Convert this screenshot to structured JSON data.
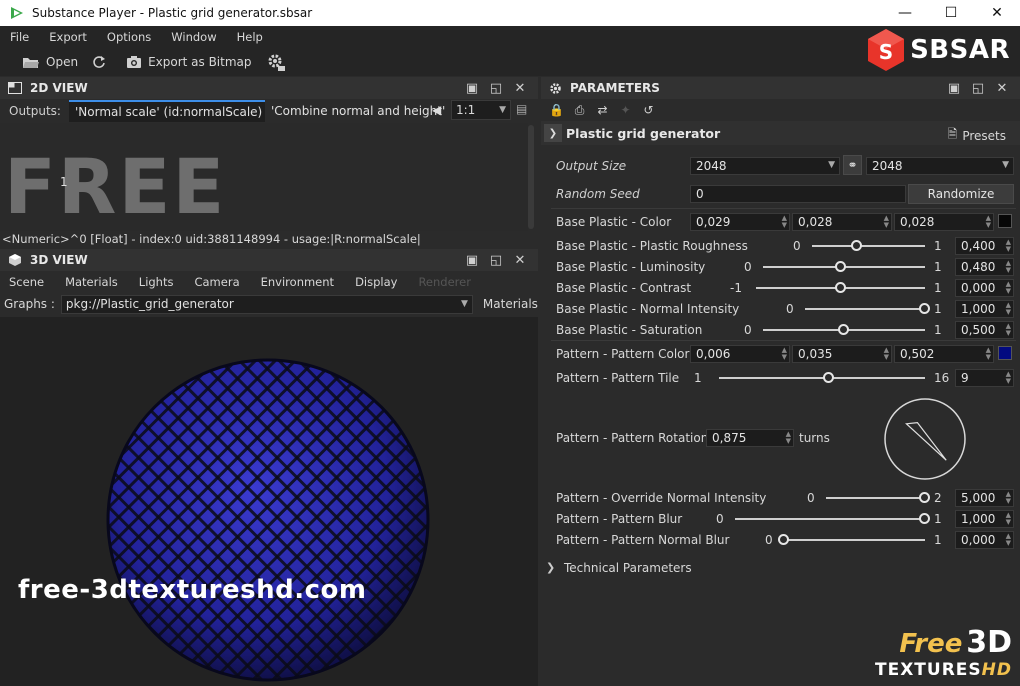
{
  "window": {
    "title": "Substance Player - Plastic grid generator.sbsar"
  },
  "menu": [
    "File",
    "Export",
    "Options",
    "Window",
    "Help"
  ],
  "toolbar": {
    "open_label": "Open",
    "export_label": "Export as Bitmap"
  },
  "logo": {
    "text": "SBSAR",
    "color": "#e8342a"
  },
  "view2d": {
    "title": "2D VIEW",
    "outputs_label": "Outputs:",
    "tab_active": "'Normal scale' (id:normalScale)",
    "tab_inactive": "'Combine normal and height' (i",
    "zoom": "1:1",
    "free_text": "FREE",
    "value_label": "1",
    "numeric_info": "<Numeric>^0 [Float] - index:0 uid:3881148994 - usage:|R:normalScale|"
  },
  "view3d": {
    "title": "3D VIEW",
    "menu": [
      "Scene",
      "Materials",
      "Lights",
      "Camera",
      "Environment",
      "Display",
      "Renderer"
    ],
    "graphs_label": "Graphs :",
    "graph_path": "pkg://Plastic_grid_generator",
    "materials_label": "Materials",
    "sphere_color": "#2a2a9e"
  },
  "parameters": {
    "title": "PARAMETERS",
    "graph_name": "Plastic grid generator",
    "presets_label": "Presets",
    "output_size_label": "Output Size",
    "output_size_w": "2048",
    "output_size_h": "2048",
    "random_seed_label": "Random Seed",
    "random_seed_value": "0",
    "randomize_label": "Randomize",
    "base_color": {
      "label": "Base Plastic  - Color",
      "r": "0,029",
      "g": "0,028",
      "b": "0,028",
      "swatch": "#070707"
    },
    "sliders": [
      {
        "label": "Base Plastic  - Plastic Roughness",
        "min": "0",
        "max": "1",
        "value": "0,400",
        "frac": 0.4
      },
      {
        "label": "Base Plastic  - Luminosity",
        "min": "0",
        "max": "1",
        "value": "0,480",
        "frac": 0.48
      },
      {
        "label": "Base Plastic  - Contrast",
        "min": "-1",
        "max": "1",
        "value": "0,000",
        "frac": 0.5
      },
      {
        "label": "Base Plastic  - Normal Intensity",
        "min": "0",
        "max": "1",
        "value": "1,000",
        "frac": 1.0
      },
      {
        "label": "Base Plastic  - Saturation",
        "min": "0",
        "max": "1",
        "value": "0,500",
        "frac": 0.5
      }
    ],
    "pattern_color": {
      "label": "Pattern - Pattern Color",
      "r": "0,006",
      "g": "0,035",
      "b": "0,502",
      "swatch": "#020a80"
    },
    "pattern_tile": {
      "label": "Pattern - Pattern Tile",
      "min": "1",
      "max": "16",
      "value": "9",
      "frac": 0.533
    },
    "pattern_rotation": {
      "label": "Pattern - Pattern Rotation",
      "value": "0,875",
      "unit": "turns",
      "turns": 0.875
    },
    "sliders2": [
      {
        "label": "Pattern - Override Normal Intensity",
        "min": "0",
        "max": "2",
        "value": "5,000",
        "frac": 1.0
      },
      {
        "label": "Pattern - Pattern Blur",
        "min": "0",
        "max": "1",
        "value": "1,000",
        "frac": 1.0
      },
      {
        "label": "Pattern - Pattern Normal Blur",
        "min": "0",
        "max": "1",
        "value": "0,000",
        "frac": 0.0
      }
    ],
    "technical_label": "Technical Parameters"
  },
  "watermarks": {
    "left": "free-3dtextureshd.com",
    "right_free": "Free",
    "right_3d": "3D",
    "right_textures": "TEXTURES",
    "right_hd": "HD"
  }
}
